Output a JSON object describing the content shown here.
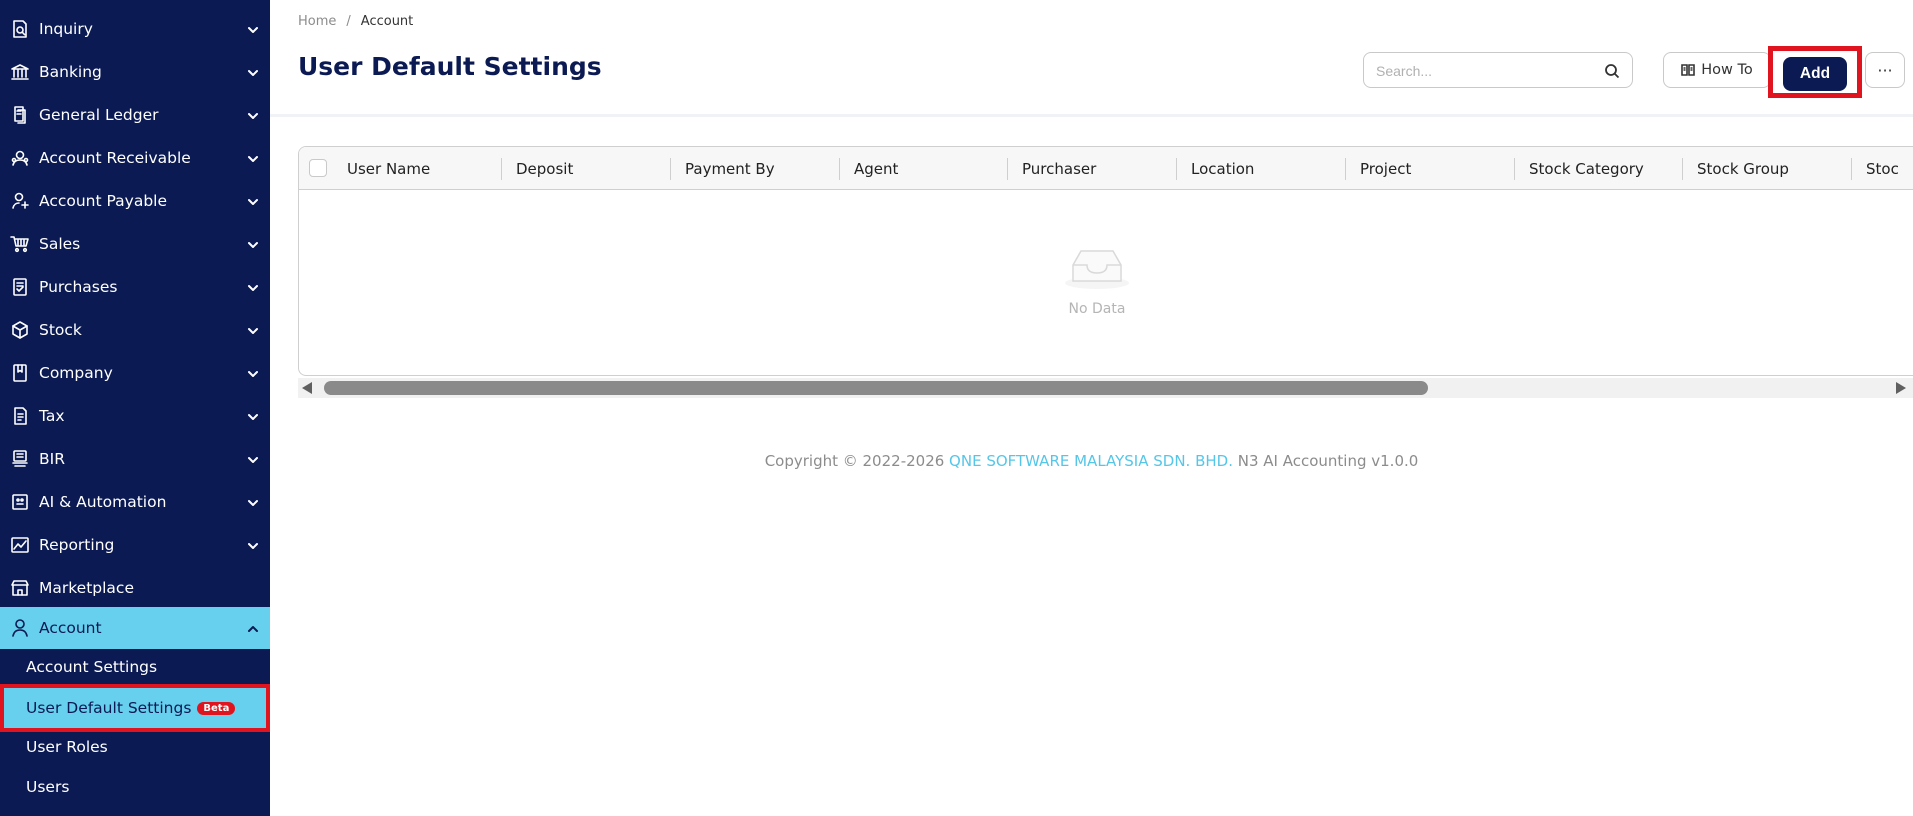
{
  "sidebar": {
    "items": [
      {
        "label": "Inquiry",
        "icon": "inquiry-icon"
      },
      {
        "label": "Banking",
        "icon": "bank-icon"
      },
      {
        "label": "General Ledger",
        "icon": "ledger-icon"
      },
      {
        "label": "Account Receivable",
        "icon": "receivable-icon"
      },
      {
        "label": "Account Payable",
        "icon": "payable-icon"
      },
      {
        "label": "Sales",
        "icon": "sales-icon"
      },
      {
        "label": "Purchases",
        "icon": "purchases-icon"
      },
      {
        "label": "Stock",
        "icon": "stock-icon"
      },
      {
        "label": "Company",
        "icon": "company-icon"
      },
      {
        "label": "Tax",
        "icon": "tax-icon"
      },
      {
        "label": "BIR",
        "icon": "bir-icon"
      },
      {
        "label": "AI & Automation",
        "icon": "ai-icon"
      },
      {
        "label": "Reporting",
        "icon": "reporting-icon"
      },
      {
        "label": "Marketplace",
        "icon": "marketplace-icon"
      },
      {
        "label": "Account",
        "icon": "user-icon",
        "active": true
      }
    ],
    "subitems": [
      {
        "label": "Account Settings"
      },
      {
        "label": "User Default Settings",
        "badge": "Beta",
        "selected": true
      },
      {
        "label": "User Roles"
      },
      {
        "label": "Users"
      }
    ]
  },
  "breadcrumb": {
    "home": "Home",
    "separator": "/",
    "current": "Account"
  },
  "page": {
    "title": "User Default Settings"
  },
  "toolbar": {
    "search_placeholder": "Search...",
    "howto_label": "How To",
    "add_label": "Add",
    "more_label": "···"
  },
  "table": {
    "columns": [
      "User Name",
      "Deposit",
      "Payment By",
      "Agent",
      "Purchaser",
      "Location",
      "Project",
      "Stock Category",
      "Stock Group",
      "Stoc"
    ],
    "empty_text": "No Data"
  },
  "footer": {
    "prefix": "Copyright © 2022-2026 ",
    "company": "QNE SOFTWARE MALAYSIA SDN. BHD.",
    "suffix": " N3 AI Accounting v1.0.0"
  },
  "colors": {
    "sidebar_bg": "#0b1a52",
    "active_bg": "#67d0ee",
    "highlight": "#e0141e",
    "primary": "#0b1a52",
    "link": "#55c6e8"
  }
}
